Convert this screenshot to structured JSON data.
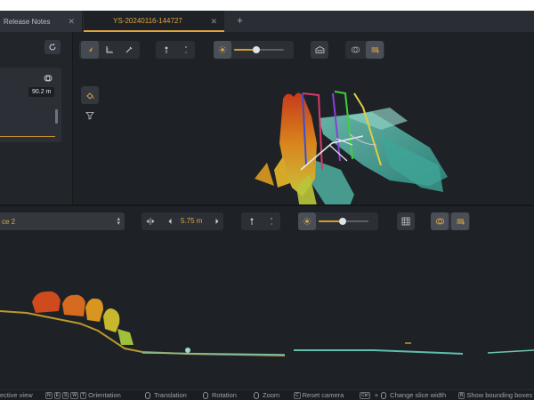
{
  "tabs": [
    {
      "label": "Release Notes",
      "close": "✕"
    },
    {
      "label": "YS-20240116-144727",
      "close": "✕"
    }
  ],
  "tab_add": "+",
  "left_panel": {
    "distance": "90.2 m"
  },
  "slice": {
    "selector_label": "ce 2",
    "width_value": "5.75 m"
  },
  "colors": {
    "accent": "#e0a53a",
    "background": "#1e2126",
    "toolbar": "#33383f"
  },
  "status_bar": {
    "perspective": "ective view",
    "orientation_keys": [
      "N",
      "E",
      "S",
      "W"
    ],
    "orientation_extra_key": "T",
    "orientation": "Orientation",
    "translation": "Translation",
    "rotation": "Rotation",
    "zoom": "Zoom",
    "reset_key": "C",
    "reset": "Reset camera",
    "ctrl_key": "Ctrl",
    "plus": "+",
    "slice_width": "Change slice width",
    "bbox_key": "B",
    "bounding_boxes": "Show bounding boxes"
  }
}
